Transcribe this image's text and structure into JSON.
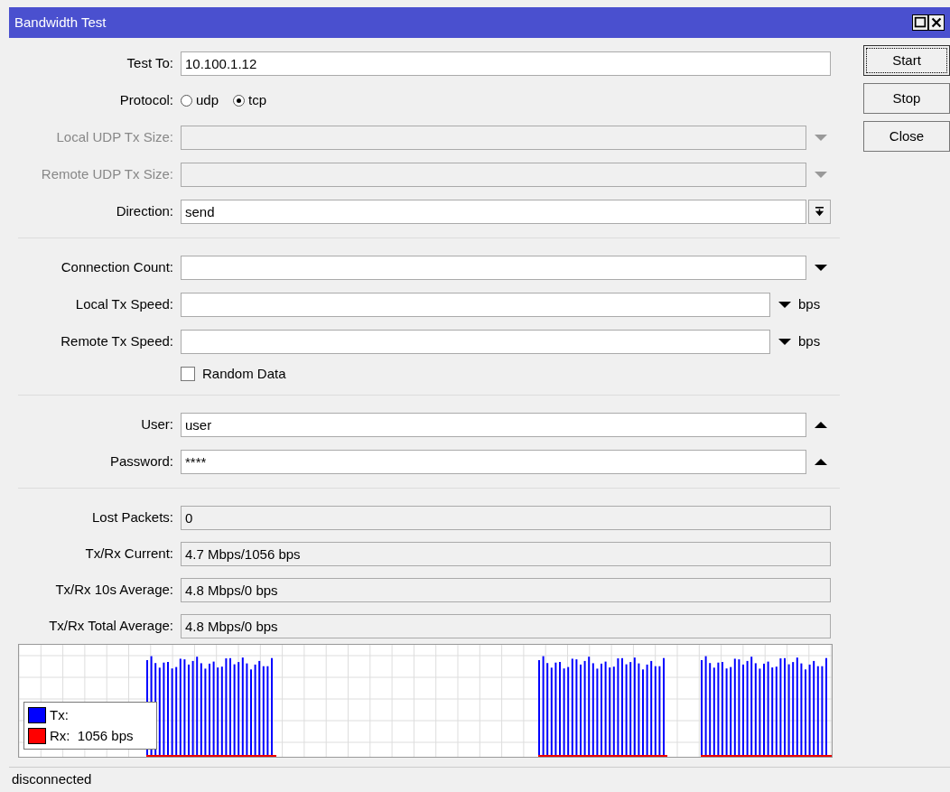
{
  "window": {
    "title": "Bandwidth Test"
  },
  "form": [
    {
      "kind": "text",
      "label": "Test To:",
      "value": "10.100.1.12",
      "disabled": false
    },
    {
      "kind": "radio",
      "label": "Protocol:",
      "disabled": false,
      "options": [
        {
          "label": "udp",
          "selected": false
        },
        {
          "label": "tcp",
          "selected": true
        }
      ]
    },
    {
      "kind": "combo",
      "label": "Local UDP Tx Size:",
      "disabled": true,
      "arrow": {
        "kind": "down"
      }
    },
    {
      "kind": "combo",
      "label": "Remote UDP Tx Size:",
      "disabled": true,
      "arrow": {
        "kind": "down"
      }
    },
    {
      "kind": "combo",
      "label": "Direction:",
      "value": "send",
      "disabled": false,
      "arrow": {
        "kind": "menu"
      }
    },
    {
      "kind": "divider"
    },
    {
      "kind": "combo",
      "label": "Connection Count:",
      "disabled": false,
      "arrow": {
        "kind": "down"
      }
    },
    {
      "kind": "combo",
      "label": "Local Tx Speed:",
      "disabled": false,
      "arrow": {
        "kind": "down"
      },
      "unit": "bps"
    },
    {
      "kind": "combo",
      "label": "Remote Tx Speed:",
      "disabled": false,
      "arrow": {
        "kind": "down"
      },
      "unit": "bps"
    },
    {
      "kind": "checkbox",
      "label": "Random Data",
      "checked": false
    },
    {
      "kind": "divider"
    },
    {
      "kind": "combo",
      "label": "User:",
      "value": "user",
      "disabled": false,
      "arrow": {
        "kind": "up"
      }
    },
    {
      "kind": "combo",
      "label": "Password:",
      "value": "****",
      "disabled": false,
      "arrow": {
        "kind": "up"
      }
    },
    {
      "kind": "divider"
    },
    {
      "kind": "readonly",
      "label": "Lost Packets:",
      "value": "0"
    },
    {
      "kind": "readonly",
      "label": "Tx/Rx Current:",
      "value": "4.7 Mbps/1056 bps"
    },
    {
      "kind": "readonly",
      "label": "Tx/Rx 10s Average:",
      "value": "4.8 Mbps/0 bps"
    },
    {
      "kind": "readonly",
      "label": "Tx/Rx Total Average:",
      "value": "4.8 Mbps/0 bps"
    }
  ],
  "graph": {
    "legend": [
      {
        "label": "Tx:",
        "color": "#0000ff"
      },
      {
        "label": "Rx:  1056 bps",
        "color": "#ff0000"
      }
    ]
  },
  "buttons": [
    {
      "label": "Start",
      "focused": true
    },
    {
      "label": "Stop",
      "focused": false
    },
    {
      "label": "Close",
      "focused": false
    }
  ],
  "status_bar": "disconnected"
}
